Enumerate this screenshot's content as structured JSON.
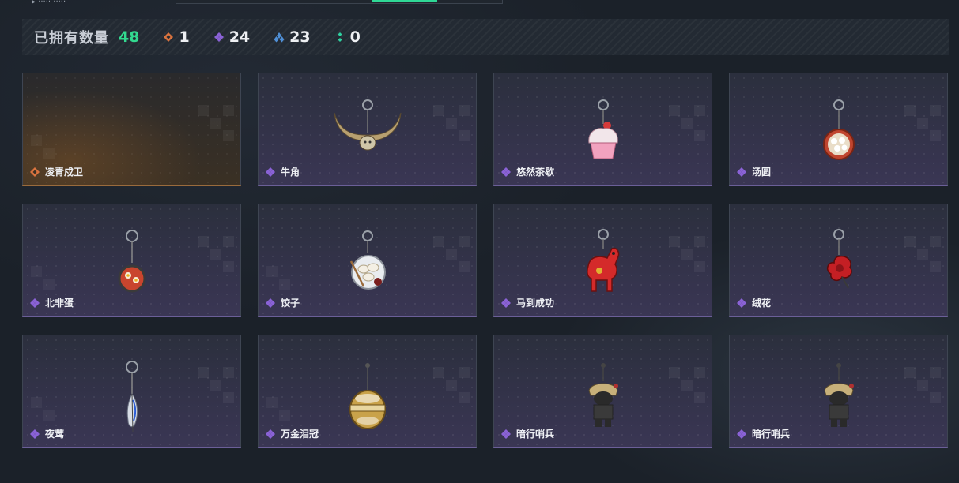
{
  "header": {
    "truncated_text": "▸ ·····  ·····"
  },
  "summary": {
    "label": "已拥有数量",
    "total": "48",
    "rarities": [
      {
        "icon": "orange-diamond-icon",
        "color": "#d9733f",
        "count": "1"
      },
      {
        "icon": "purple-diamond-icon",
        "color": "#8a62d6",
        "count": "24"
      },
      {
        "icon": "blue-diamond-icon",
        "color": "#4f8fd6",
        "count": "23"
      },
      {
        "icon": "green-dots-icon",
        "color": "#2fd0a0",
        "count": "0"
      }
    ]
  },
  "items": [
    {
      "name": "凌青戍卫",
      "rarity": "orange",
      "art": "none"
    },
    {
      "name": "牛角",
      "rarity": "purple",
      "art": "horn-charm"
    },
    {
      "name": "悠然茶歇",
      "rarity": "purple",
      "art": "cupcake-charm"
    },
    {
      "name": "汤圆",
      "rarity": "purple",
      "art": "tangyuan-charm"
    },
    {
      "name": "北非蛋",
      "rarity": "purple",
      "art": "shakshuka-charm"
    },
    {
      "name": "饺子",
      "rarity": "purple",
      "art": "dumpling-charm"
    },
    {
      "name": "马到成功",
      "rarity": "purple",
      "art": "red-horse-charm"
    },
    {
      "name": "绒花",
      "rarity": "purple",
      "art": "velvet-flower-charm"
    },
    {
      "name": "夜莺",
      "rarity": "purple",
      "art": "feather-charm"
    },
    {
      "name": "万金泪冠",
      "rarity": "purple",
      "art": "golden-egg-charm"
    },
    {
      "name": "暗行哨兵",
      "rarity": "purple",
      "art": "soldier-charm"
    },
    {
      "name": "暗行哨兵",
      "rarity": "purple",
      "art": "soldier-charm"
    }
  ],
  "colors": {
    "accent_green": "#32d98f",
    "card_border_purple": "#6b5f98",
    "card_border_gold": "#9a6b3c"
  }
}
